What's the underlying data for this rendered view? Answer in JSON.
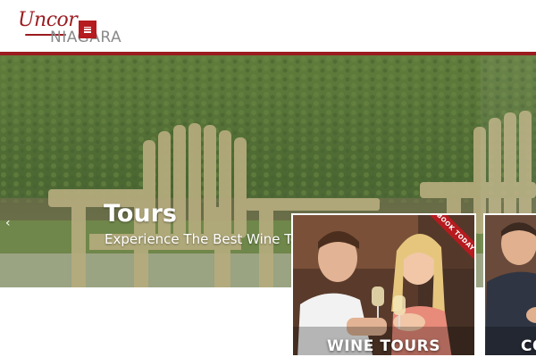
{
  "header": {
    "logo_script": "Uncor",
    "logo_niagara": "NIAGARA",
    "menu_icon": "hamburger-icon"
  },
  "hero": {
    "title": "Tours",
    "subtitle": "Experience The Best Wine Tours in Niagara.",
    "prev_arrow": "‹"
  },
  "cards": [
    {
      "label": "WINE TOURS",
      "ribbon": "BOOK TODAY"
    },
    {
      "label": "CO"
    }
  ],
  "colors": {
    "brand": "#9b1b1f",
    "accent": "#b51b1f"
  }
}
